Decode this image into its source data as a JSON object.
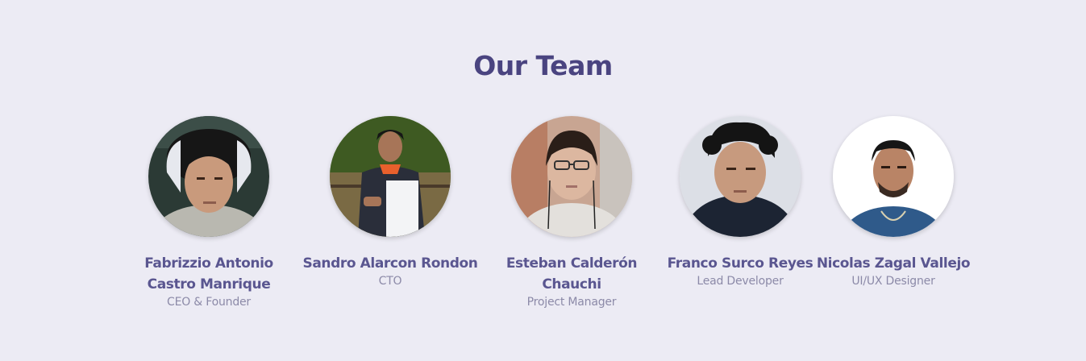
{
  "section": {
    "title": "Our Team"
  },
  "members": [
    {
      "name": "Fabrizzio Antonio Castro Manrique",
      "role": "CEO & Founder",
      "photo": "person-photo"
    },
    {
      "name": "Sandro Alarcon Rondon",
      "role": "CTO",
      "photo": "person-photo"
    },
    {
      "name": "Esteban Calderón Chauchi",
      "role": "Project Manager",
      "photo": "person-photo"
    },
    {
      "name": "Franco Surco Reyes",
      "role": "Lead Developer",
      "photo": "person-photo"
    },
    {
      "name": "Nicolas Zagal Vallejo",
      "role": "UI/UX Designer",
      "photo": "person-photo"
    }
  ],
  "colors": {
    "background": "#ecebf4",
    "title": "#4a4480",
    "name": "#5a5690",
    "role": "#8c8aa8"
  }
}
